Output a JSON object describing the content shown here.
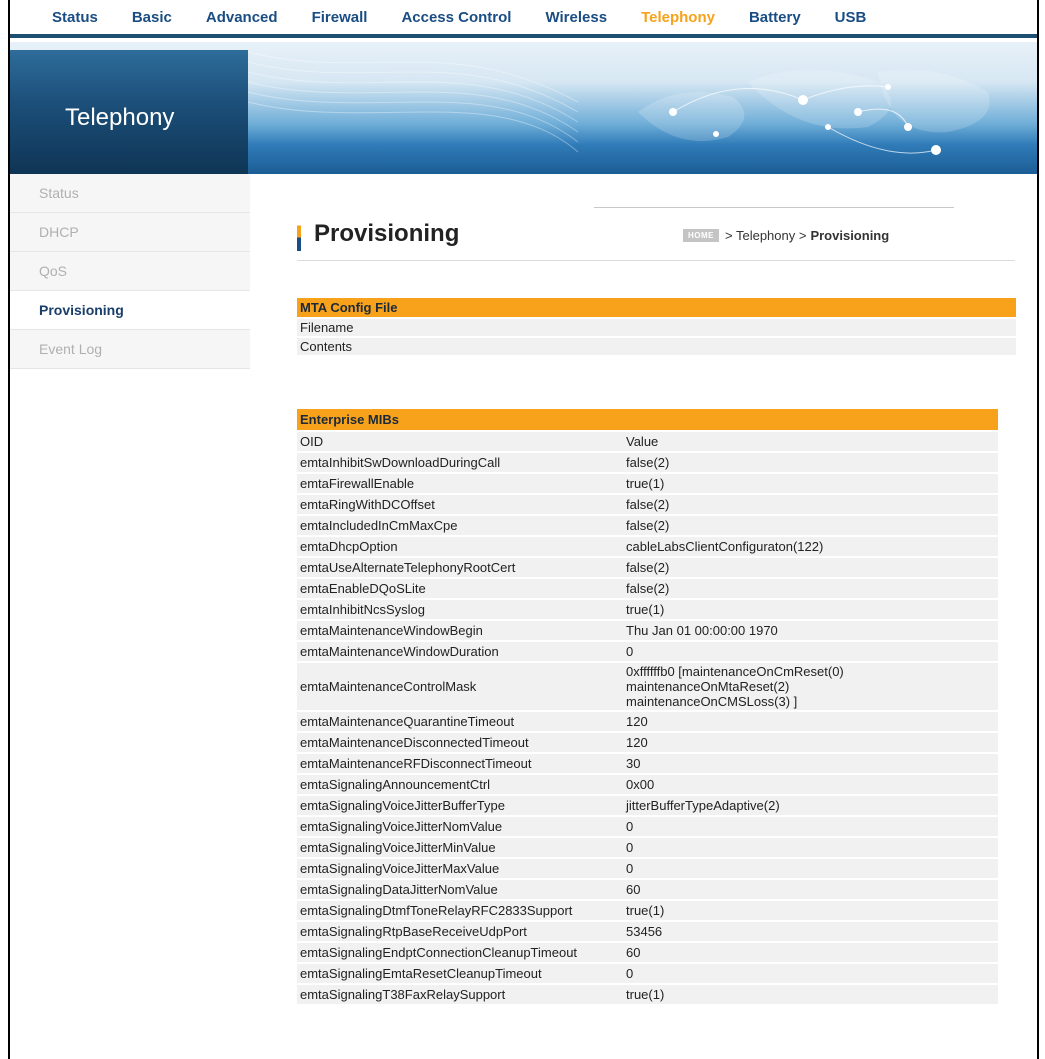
{
  "topnav": [
    {
      "label": "Status",
      "active": false
    },
    {
      "label": "Basic",
      "active": false
    },
    {
      "label": "Advanced",
      "active": false
    },
    {
      "label": "Firewall",
      "active": false
    },
    {
      "label": "Access Control",
      "active": false
    },
    {
      "label": "Wireless",
      "active": false
    },
    {
      "label": "Telephony",
      "active": true
    },
    {
      "label": "Battery",
      "active": false
    },
    {
      "label": "USB",
      "active": false
    }
  ],
  "banner": {
    "title": "Telephony"
  },
  "sidebar": [
    {
      "label": "Status",
      "active": false
    },
    {
      "label": "DHCP",
      "active": false
    },
    {
      "label": "QoS",
      "active": false
    },
    {
      "label": "Provisioning",
      "active": true
    },
    {
      "label": "Event Log",
      "active": false
    }
  ],
  "page": {
    "title": "Provisioning",
    "breadcrumb": {
      "home": "HOME",
      "path": "> Telephony >",
      "current": "Provisioning"
    }
  },
  "mta_config": {
    "header": "MTA Config File",
    "rows": [
      {
        "label": "Filename",
        "value": ""
      },
      {
        "label": "Contents",
        "value": ""
      }
    ]
  },
  "enterprise_mibs": {
    "header": "Enterprise MIBs",
    "columns": [
      "OID",
      "Value"
    ],
    "rows": [
      {
        "oid": "emtaInhibitSwDownloadDuringCall",
        "value": "false(2)"
      },
      {
        "oid": "emtaFirewallEnable",
        "value": "true(1)"
      },
      {
        "oid": "emtaRingWithDCOffset",
        "value": "false(2)"
      },
      {
        "oid": "emtaIncludedInCmMaxCpe",
        "value": "false(2)"
      },
      {
        "oid": "emtaDhcpOption",
        "value": "cableLabsClientConfiguraton(122)"
      },
      {
        "oid": "emtaUseAlternateTelephonyRootCert",
        "value": "false(2)"
      },
      {
        "oid": "emtaEnableDQoSLite",
        "value": "false(2)"
      },
      {
        "oid": "emtaInhibitNcsSyslog",
        "value": "true(1)"
      },
      {
        "oid": "emtaMaintenanceWindowBegin",
        "value": "Thu Jan 01 00:00:00 1970"
      },
      {
        "oid": "emtaMaintenanceWindowDuration",
        "value": "0"
      },
      {
        "oid": "emtaMaintenanceControlMask",
        "value": "0xffffffb0 [maintenanceOnCmReset(0)\nmaintenanceOnMtaReset(2)\nmaintenanceOnCMSLoss(3) ]"
      },
      {
        "oid": "emtaMaintenanceQuarantineTimeout",
        "value": "120"
      },
      {
        "oid": "emtaMaintenanceDisconnectedTimeout",
        "value": "120"
      },
      {
        "oid": "emtaMaintenanceRFDisconnectTimeout",
        "value": "30"
      },
      {
        "oid": "emtaSignalingAnnouncementCtrl",
        "value": "0x00"
      },
      {
        "oid": "emtaSignalingVoiceJitterBufferType",
        "value": "jitterBufferTypeAdaptive(2)"
      },
      {
        "oid": "emtaSignalingVoiceJitterNomValue",
        "value": "0"
      },
      {
        "oid": "emtaSignalingVoiceJitterMinValue",
        "value": "0"
      },
      {
        "oid": "emtaSignalingVoiceJitterMaxValue",
        "value": "0"
      },
      {
        "oid": "emtaSignalingDataJitterNomValue",
        "value": "60"
      },
      {
        "oid": "emtaSignalingDtmfToneRelayRFC2833Support",
        "value": "true(1)"
      },
      {
        "oid": "emtaSignalingRtpBaseReceiveUdpPort",
        "value": "53456"
      },
      {
        "oid": "emtaSignalingEndptConnectionCleanupTimeout",
        "value": "60"
      },
      {
        "oid": "emtaSignalingEmtaResetCleanupTimeout",
        "value": "0"
      },
      {
        "oid": "emtaSignalingT38FaxRelaySupport",
        "value": "true(1)"
      }
    ]
  },
  "colors": {
    "accent": "#f7a21a",
    "nav": "#1a4d83",
    "banner_dark": "#0f3555"
  }
}
